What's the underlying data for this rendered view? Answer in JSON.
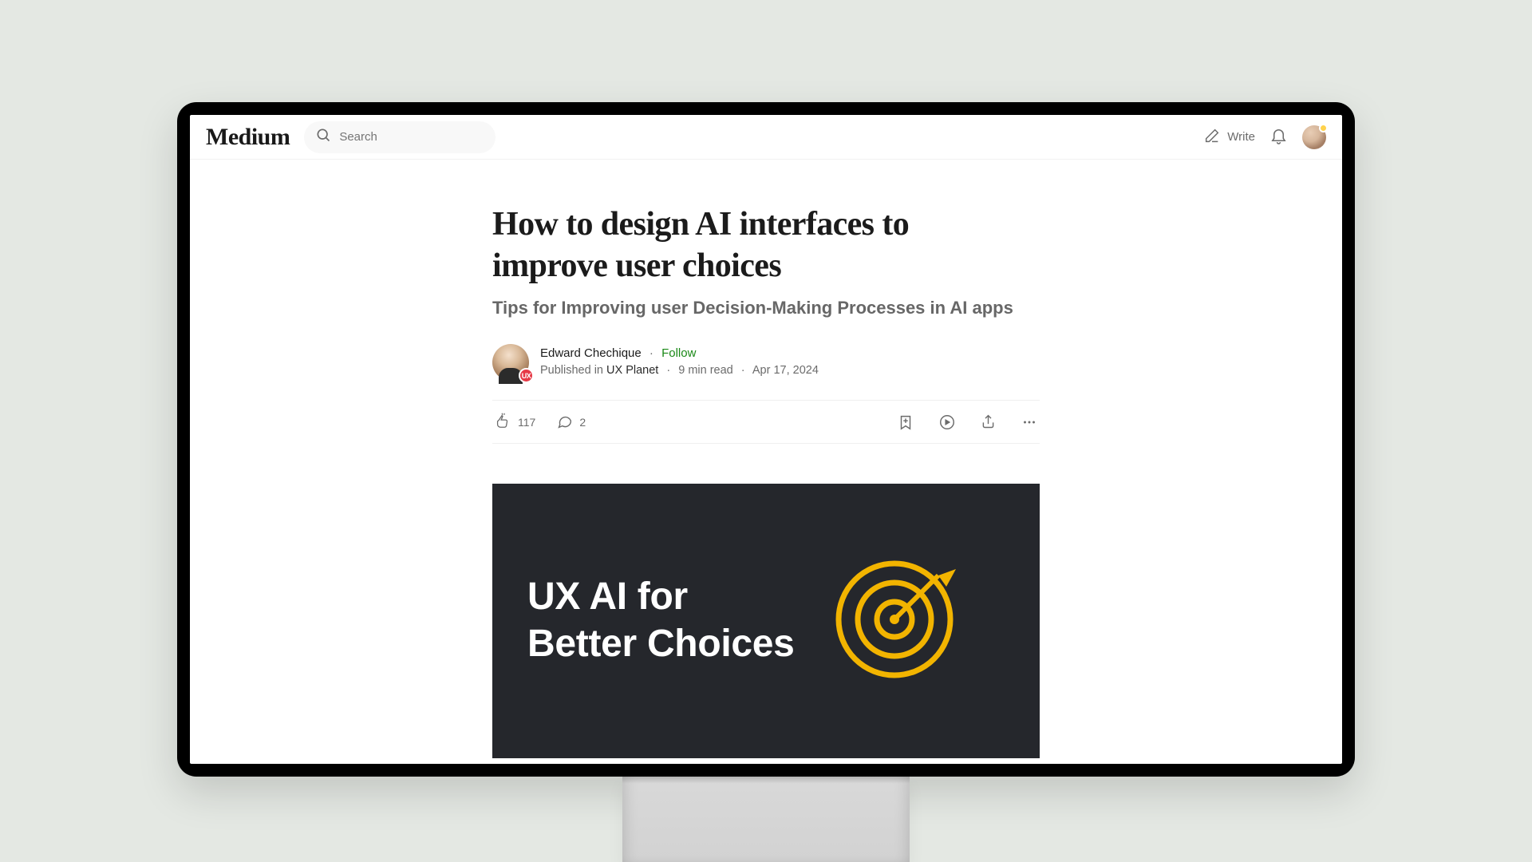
{
  "nav": {
    "logo": "Medium",
    "search_placeholder": "Search",
    "write_label": "Write"
  },
  "article": {
    "title": "How to design AI interfaces to improve user choices",
    "subtitle": "Tips for Improving user Decision-Making Processes in AI apps",
    "author_name": "Edward Chechique",
    "follow_label": "Follow",
    "published_prefix": "Published in",
    "publication": "UX Planet",
    "read_time": "9 min read",
    "date": "Apr 17, 2024",
    "pub_badge": "UX"
  },
  "engagement": {
    "claps": "117",
    "comments": "2"
  },
  "hero": {
    "line1": "UX AI  for",
    "line2": "Better Choices"
  }
}
